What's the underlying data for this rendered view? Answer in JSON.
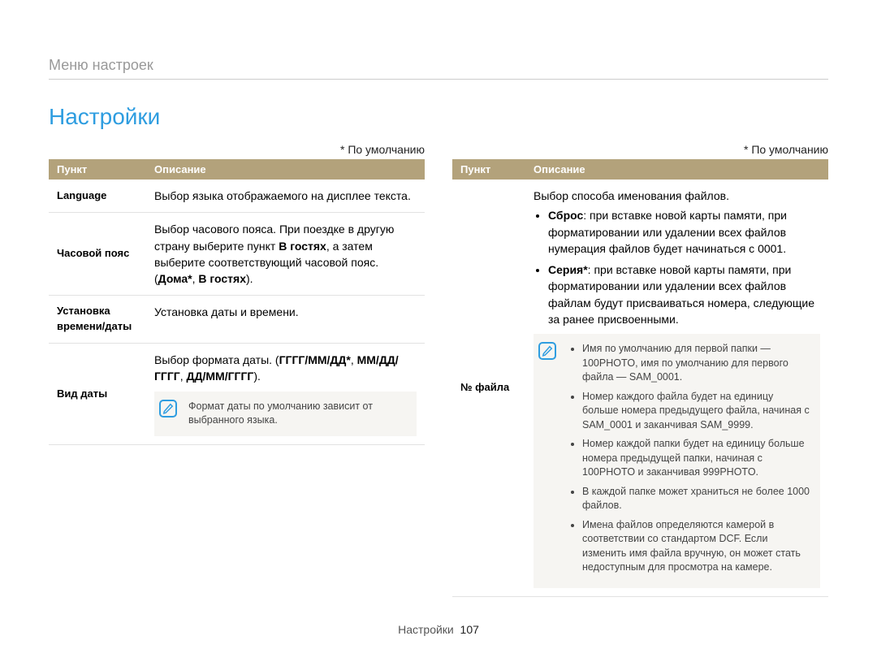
{
  "breadcrumb": "Меню настроек",
  "title": "Настройки",
  "default_label": "* По умолчанию",
  "headers": {
    "item": "Пункт",
    "desc": "Описание"
  },
  "left": {
    "rows": [
      {
        "item": "Language",
        "desc_plain": "Выбор языка отображаемого на дисплее текста."
      },
      {
        "item": "Часовой пояс",
        "desc_parts": {
          "pre": "Выбор часового пояса. При поездке в другую страну выберите пункт ",
          "b1": "В гостях",
          "mid": ", а затем выберите соответствующий часовой пояс. (",
          "b2": "Дома*",
          "sep": ", ",
          "b3": "В гостях",
          "post": ")."
        }
      },
      {
        "item": "Установка времени/даты",
        "desc_plain": "Установка даты и времени."
      },
      {
        "item": "Вид даты",
        "desc_parts": {
          "pre": "Выбор формата даты. (",
          "b1": "ГГГГ/ММ/ДД*",
          "sep1": ", ",
          "b2": "ММ/ДД/ГГГГ",
          "sep2": ", ",
          "b3": "ДД/ММ/ГГГГ",
          "post": ")."
        },
        "note": "Формат даты по умолчанию зависит от выбранного языка."
      }
    ]
  },
  "right": {
    "row": {
      "item": "№ файла",
      "intro": "Выбор способа именования файлов.",
      "opts": [
        {
          "label": "Сброс",
          "text": ": при вставке новой карты памяти, при форматировании или удалении всех файлов нумерация файлов будет начинаться с 0001."
        },
        {
          "label": "Серия*",
          "text": ": при вставке новой карты памяти, при форматировании или удалении всех файлов файлам будут присваиваться номера, следующие за ранее присвоенными."
        }
      ],
      "notes": [
        "Имя по умолчанию для первой папки — 100PHOTO, имя по умолчанию для первого файла — SAM_0001.",
        "Номер каждого файла будет на единицу больше номера предыдущего файла, начиная с SAM_0001 и заканчивая SAM_9999.",
        "Номер каждой папки будет на единицу больше номера предыдущей папки, начиная с 100PHOTO и заканчивая 999PHOTO.",
        "В каждой папке может храниться не более 1000 файлов.",
        "Имена файлов определяются камерой в соответствии со стандартом DCF. Если изменить имя файла вручную, он может стать недоступным для просмотра на камере."
      ]
    }
  },
  "footer": {
    "section": "Настройки",
    "page": "107"
  }
}
